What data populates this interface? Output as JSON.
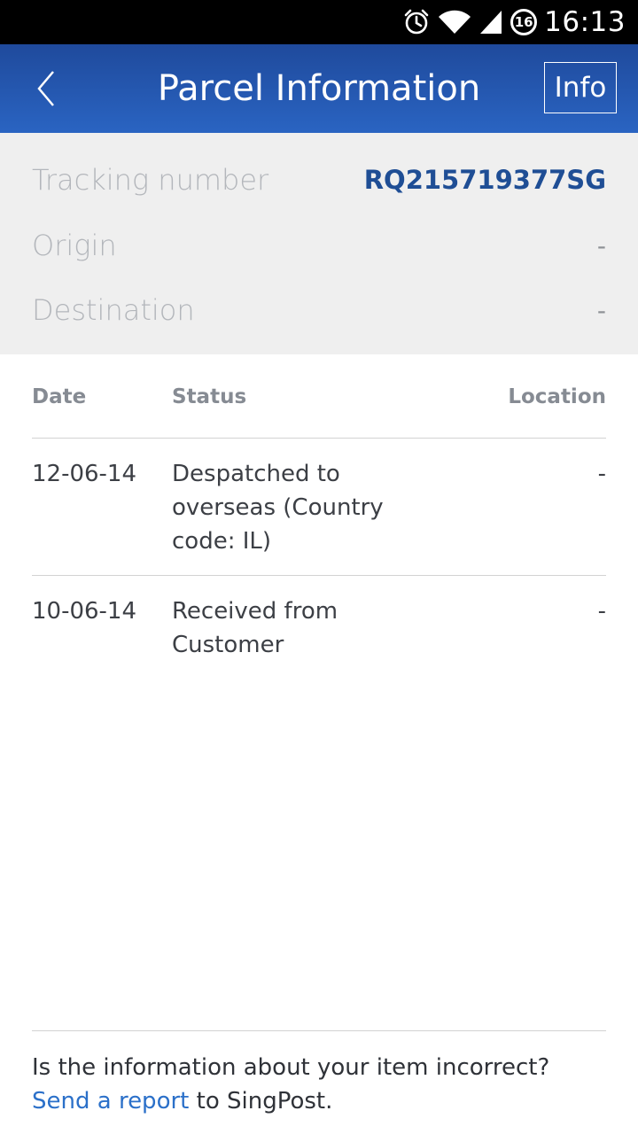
{
  "status_bar": {
    "time": "16:13",
    "notification_count": "16",
    "icons": [
      "alarm-icon",
      "wifi-icon",
      "signal-icon",
      "notification-badge"
    ]
  },
  "app_bar": {
    "title": "Parcel Information",
    "info_label": "Info",
    "back_icon": "chevron-left-icon",
    "colors": {
      "top": "#1f4a9c",
      "bottom": "#2a64c2"
    }
  },
  "summary": {
    "tracking_label": "Tracking number",
    "tracking_value": "RQ215719377SG",
    "origin_label": "Origin",
    "origin_value": "-",
    "destination_label": "Destination",
    "destination_value": "-"
  },
  "table": {
    "headers": {
      "date": "Date",
      "status": "Status",
      "location": "Location"
    },
    "rows": [
      {
        "date": "12-06-14",
        "status": "Despatched to overseas (Country code: IL)",
        "location": "-"
      },
      {
        "date": "10-06-14",
        "status": "Received from Customer",
        "location": "-"
      }
    ]
  },
  "footer": {
    "question": "Is the information about your item incorrect?",
    "link_text": "Send a report",
    "suffix": " to SingPost."
  }
}
